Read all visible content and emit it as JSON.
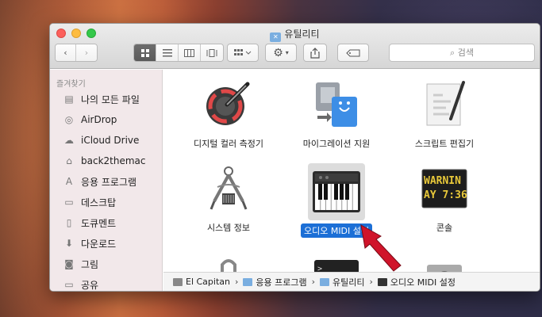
{
  "window": {
    "title": "유틸리티"
  },
  "toolbar": {
    "search_placeholder": "검색"
  },
  "sidebar": {
    "header": "즐겨찾기",
    "items": [
      {
        "label": "나의 모든 파일",
        "icon": "all-files-icon"
      },
      {
        "label": "AirDrop",
        "icon": "airdrop-icon"
      },
      {
        "label": "iCloud Drive",
        "icon": "cloud-icon"
      },
      {
        "label": "back2themac",
        "icon": "home-icon"
      },
      {
        "label": "응용 프로그램",
        "icon": "applications-icon"
      },
      {
        "label": "데스크탑",
        "icon": "desktop-icon"
      },
      {
        "label": "도큐멘트",
        "icon": "document-icon"
      },
      {
        "label": "다운로드",
        "icon": "download-icon"
      },
      {
        "label": "그림",
        "icon": "camera-icon"
      },
      {
        "label": "공유",
        "icon": "folder-icon"
      }
    ]
  },
  "files": [
    {
      "label": "디지털 컬러 측정기",
      "icon": "color-meter-icon"
    },
    {
      "label": "마이그레이션 지원",
      "icon": "migration-icon"
    },
    {
      "label": "스크립트 편집기",
      "icon": "script-editor-icon"
    },
    {
      "label": "시스템 정보",
      "icon": "system-info-icon"
    },
    {
      "label": "오디오 MIDI 설정",
      "icon": "piano-keyboard-icon",
      "selected": true
    },
    {
      "label": "콘솔",
      "icon": "console-icon"
    }
  ],
  "console_text": [
    "WARNIN",
    "AY 7:36"
  ],
  "path": [
    "El Capitan",
    "응용 프로그램",
    "유틸리티",
    "오디오 MIDI 설정"
  ],
  "colors": {
    "selection": "#1c6fd6",
    "sidebar_bg": "#f2e8ea",
    "annotation_arrow": "#d0142a"
  }
}
